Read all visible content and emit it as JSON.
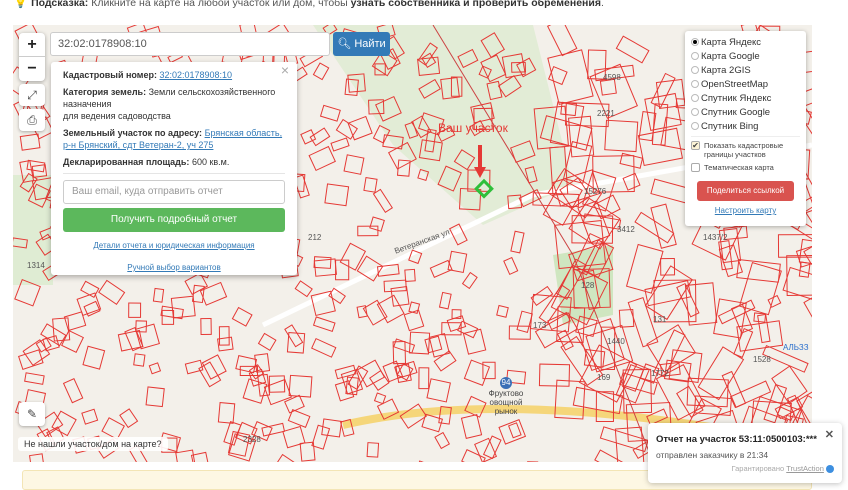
{
  "hint": {
    "label": "Подсказка:",
    "text": " Кликните на карте на любой участок или дом, чтобы ",
    "bold": "узнать собственника и проверить обременения",
    "end": "."
  },
  "search": {
    "value": "32:02:0178908:10",
    "button": "Найти"
  },
  "zoom": {
    "in": "+",
    "out": "−"
  },
  "popup": {
    "cad_label": "Кадастровый номер:",
    "cad_value": "32:02:0178908:10",
    "cat_label": "Категория земель:",
    "cat_value": "Земли сельскохозяйственного назначения",
    "use": "для ведения садоводства",
    "addr_label": "Земельный участок по адресу:",
    "addr_value": "Брянская область, р-н Брянский, сдт Ветеран-2, уч 275",
    "area_label": "Декларированная площадь:",
    "area_value": "600 кв.м.",
    "email_placeholder": "Ваш email, куда отправить отчет",
    "get_report": "Получить подробный отчет",
    "details_link": "Детали отчета и юридическая информация",
    "manual_link": "Ручной выбор вариантов"
  },
  "layers": {
    "options": [
      "Карта Яндекс",
      "Карта Google",
      "Карта 2GIS",
      "OpenStreetMap",
      "Спутник Яндекс",
      "Спутник Google",
      "Спутник Bing"
    ],
    "selected": "Карта Яндекс",
    "show_borders": "Показать кадастровые границы участков",
    "thematic": "Тематическая карта",
    "share": "Поделиться ссылкой",
    "configure": "Настроить карту"
  },
  "map": {
    "your_plot": "Ваш участок",
    "not_found": "Не нашли участок/дом на карте?",
    "street": "Ветеранская ул",
    "market": "Фруктово овощной рынок",
    "market_num": "94",
    "labels": [
      "1314",
      "212",
      "4598",
      "2221",
      "15276",
      "3412",
      "1437/2",
      "128",
      "173",
      "131",
      "1440",
      "169",
      "1772",
      "1528",
      "2328",
      "АЛЬЗЗ"
    ]
  },
  "toast": {
    "title": "Отчет на участок 53:11:0500103:***",
    "subtitle": "отправлен заказчику в 21:34",
    "guarantee": "Гарантировано",
    "brand": "TrustAction"
  },
  "colors": {
    "parcel": "#e53935",
    "primary": "#337ab7",
    "success": "#5cb85c",
    "danger": "#d9534f"
  }
}
